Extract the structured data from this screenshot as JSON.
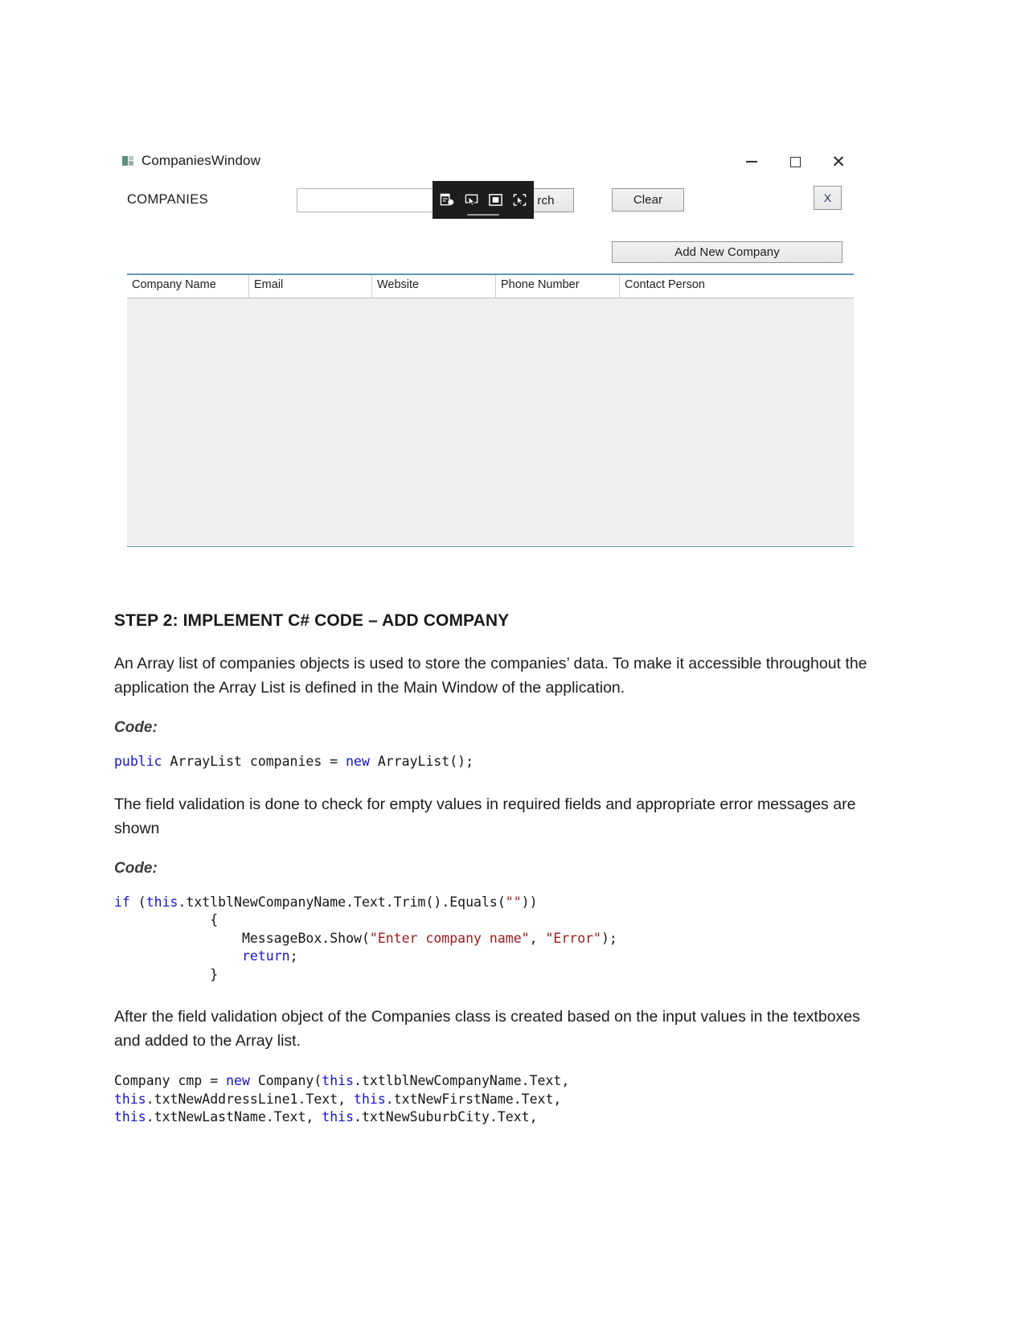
{
  "app": {
    "title": "CompaniesWindow",
    "icon": "app-window-icon",
    "window_controls": {
      "minimize": "minimize-icon",
      "maximize": "maximize-icon",
      "close": "close-icon"
    },
    "section_label": "COMPANIES",
    "search": {
      "value": "",
      "placeholder": ""
    },
    "buttons": {
      "search": "Search",
      "search_visible_text": "rch",
      "clear": "Clear",
      "close_x": "X",
      "add_new_company": "Add New Company"
    },
    "grid": {
      "columns": [
        "Company Name",
        "Email",
        "Website",
        "Phone Number",
        "Contact Person"
      ],
      "rows": []
    },
    "snip_toolbar": {
      "items": [
        "new-snip-icon",
        "window-snip-icon",
        "fullscreen-snip-icon",
        "freeform-snip-icon"
      ]
    },
    "colors": {
      "grid_rule": "#5d9ab2",
      "grid_body": "#efefef",
      "toolbar_bg": "#1d1d1d"
    }
  },
  "document": {
    "heading": "STEP 2: IMPLEMENT C# CODE – ADD COMPANY",
    "para1": "An Array list of companies objects is used to store the companies’ data. To make it accessible throughout the application the Array List is defined in the Main Window of the application.",
    "code_label_1": "Code:",
    "code_block_1": [
      {
        "kw": "public",
        "plain": " ArrayList companies = "
      },
      {
        "kw": "new",
        "plain": " ArrayList();"
      }
    ],
    "para2": "The field validation is done to check for empty values in required fields and appropriate error messages are shown",
    "code_label_2": "Code:",
    "code_block_2_lines": [
      "if (this.txtlblNewCompanyName.Text.Trim().Equals(\"\"))",
      "            {",
      "                MessageBox.Show(\"Enter company name\", \"Error\");",
      "                return;",
      "            }"
    ],
    "para3": "After the field validation object of the Companies class is created based on the input values in the textboxes and added to the Array list.",
    "code_block_3_lines": [
      "Company cmp = new Company(this.txtlblNewCompanyName.Text,",
      "this.txtNewAddressLine1.Text, this.txtNewFirstName.Text,",
      "this.txtNewLastName.Text, this.txtNewSuburbCity.Text,"
    ],
    "colors": {
      "keyword": "#1414cf",
      "string": "#a01a1a"
    }
  }
}
